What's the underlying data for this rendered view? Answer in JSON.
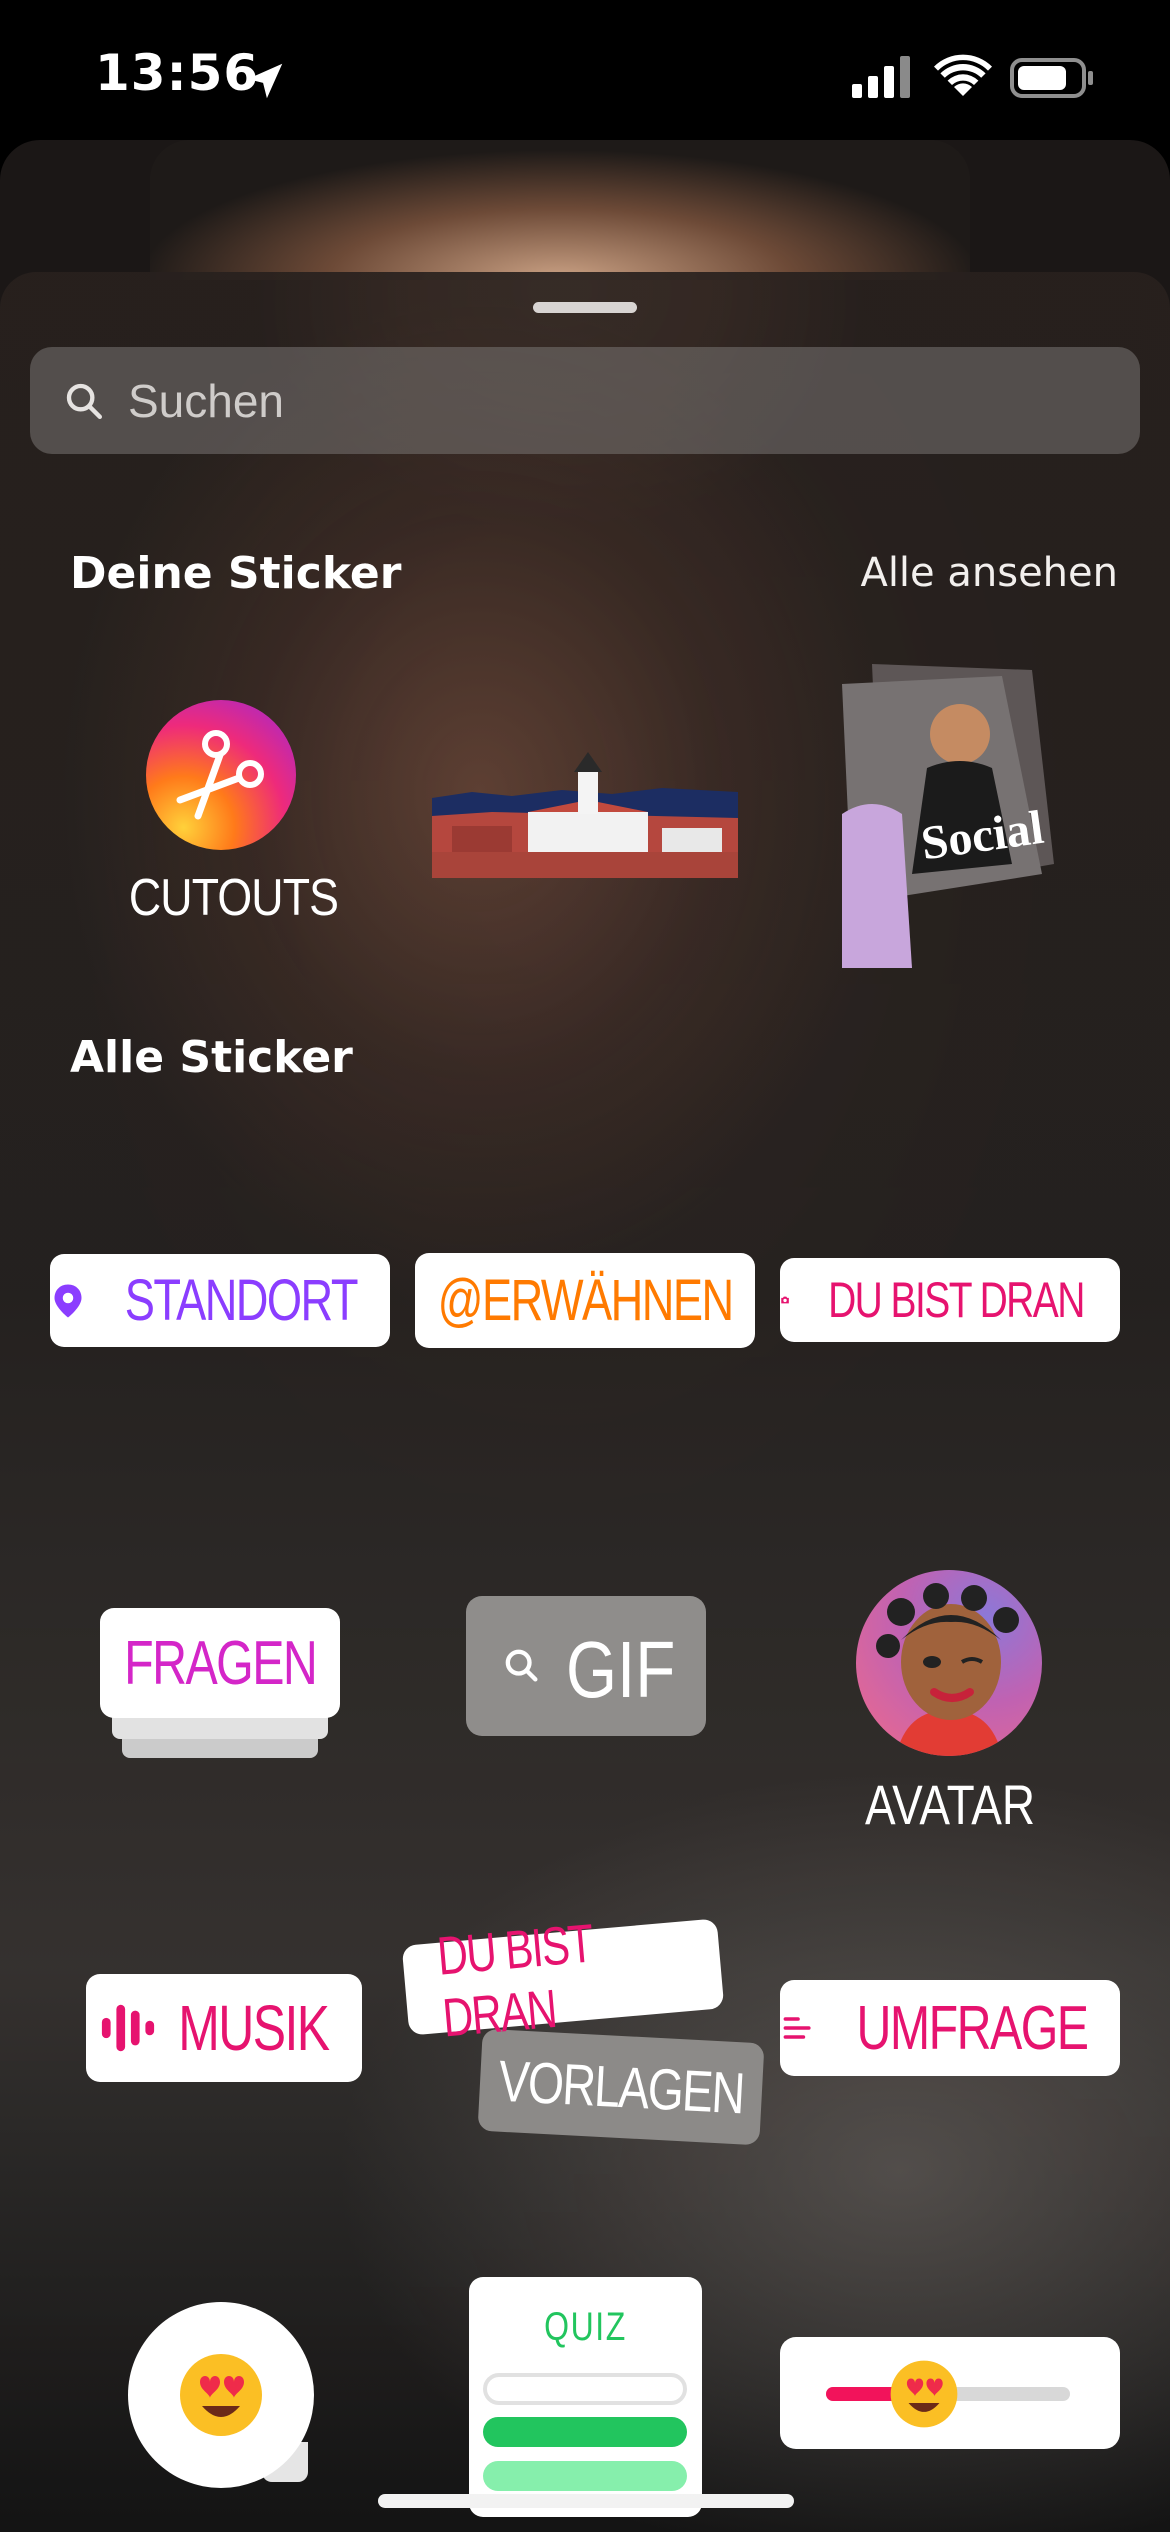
{
  "status_bar": {
    "time": "13:56"
  },
  "search": {
    "placeholder": "Suchen"
  },
  "sections": {
    "your_stickers": "Deine Sticker",
    "see_all": "Alle ansehen",
    "all_stickers": "Alle Sticker"
  },
  "your_stickers": {
    "cutouts_label": "CUTOUTS"
  },
  "stickers": {
    "location": "STANDORT",
    "mention": "@ERWÄHNEN",
    "your_turn": "DU BIST DRAN",
    "questions": "FRAGEN",
    "gif": "GIF",
    "avatar": "AVATAR",
    "music": "MUSIK",
    "templates_top": "DU BIST DRAN",
    "templates_bottom": "VORLAGEN",
    "poll": "UMFRAGE",
    "quiz": "QUIZ",
    "slider_value": 0.4
  },
  "magazine_text": "Social",
  "colors": {
    "location": "#8b3dff",
    "mention": "#ff7a00",
    "pink": "#e6136f",
    "questions": "#d426c8",
    "quiz_green": "#22c55e"
  },
  "icons": [
    "location-arrow-icon",
    "signal-icon",
    "wifi-icon",
    "battery-icon",
    "search-icon",
    "scissors-icon",
    "pin-icon",
    "camera-icon",
    "music-bars-icon",
    "poll-lines-icon",
    "heart-eyes-emoji-icon"
  ]
}
